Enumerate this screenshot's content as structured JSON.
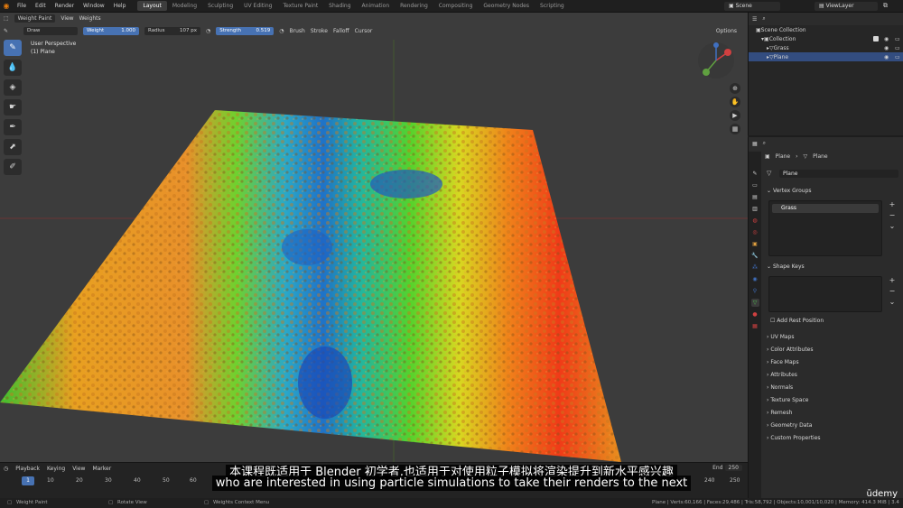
{
  "topbar": {
    "menu": [
      "File",
      "Edit",
      "Render",
      "Window",
      "Help"
    ],
    "workspaces": [
      "Layout",
      "Modeling",
      "Sculpting",
      "UV Editing",
      "Texture Paint",
      "Shading",
      "Animation",
      "Rendering",
      "Compositing",
      "Geometry Nodes",
      "Scripting"
    ],
    "active_workspace": "Layout",
    "scene": "Scene",
    "view_layer": "ViewLayer"
  },
  "viewport": {
    "mode": "Weight Paint",
    "menus": [
      "View",
      "Weights"
    ],
    "tool": "Draw",
    "weight_label": "Weight",
    "weight_value": "1.000",
    "radius_label": "Radius",
    "radius_value": "107 px",
    "strength_label": "Strength",
    "strength_value": "0.519",
    "tool_menus": [
      "Brush",
      "Stroke",
      "Falloff",
      "Cursor"
    ],
    "options": "Options",
    "perspective": "User Perspective",
    "object": "(1) Plane"
  },
  "timeline": {
    "menus": [
      "Playback",
      "Keying",
      "View",
      "Marker"
    ],
    "current_frame": "1",
    "ruler": [
      "10",
      "20",
      "30",
      "40",
      "50",
      "60",
      "200",
      "210",
      "220",
      "230",
      "240",
      "250"
    ],
    "end_label": "End",
    "end_value": "250"
  },
  "outliner": {
    "root": "Scene Collection",
    "items": [
      "Collection",
      "Grass",
      "Plane"
    ]
  },
  "properties": {
    "crumb_object": "Plane",
    "crumb_data": "Plane",
    "data_name": "Plane",
    "vertex_groups_title": "Vertex Groups",
    "vertex_group_item": "Grass",
    "shape_keys_title": "Shape Keys",
    "add_rest_position": "Add Rest Position",
    "panels": [
      "UV Maps",
      "Color Attributes",
      "Face Maps",
      "Attributes",
      "Normals",
      "Texture Space",
      "Remesh",
      "Geometry Data",
      "Custom Properties"
    ]
  },
  "statusbar": {
    "left": "Weight Paint",
    "mid1": "Rotate View",
    "mid2": "Weights Context Menu",
    "right": "Plane | Verts:60,166 | Faces:29,486 | Tris:58,792 | Objects:10,001/10,020 | Memory: 414.3 MiB | 3.4"
  },
  "subtitles": {
    "zh": "本课程既适用于 Blender 初学者,也适用于对使用粒子模拟将渲染提升到新水平感兴趣",
    "en": "who are interested in using particle simulations to take their renders to the next"
  },
  "watermark": "ūdemy",
  "colors": {
    "accent_blue": "#4772b3",
    "selected_row": "#334d80",
    "blender_orange": "#e87d0d"
  }
}
